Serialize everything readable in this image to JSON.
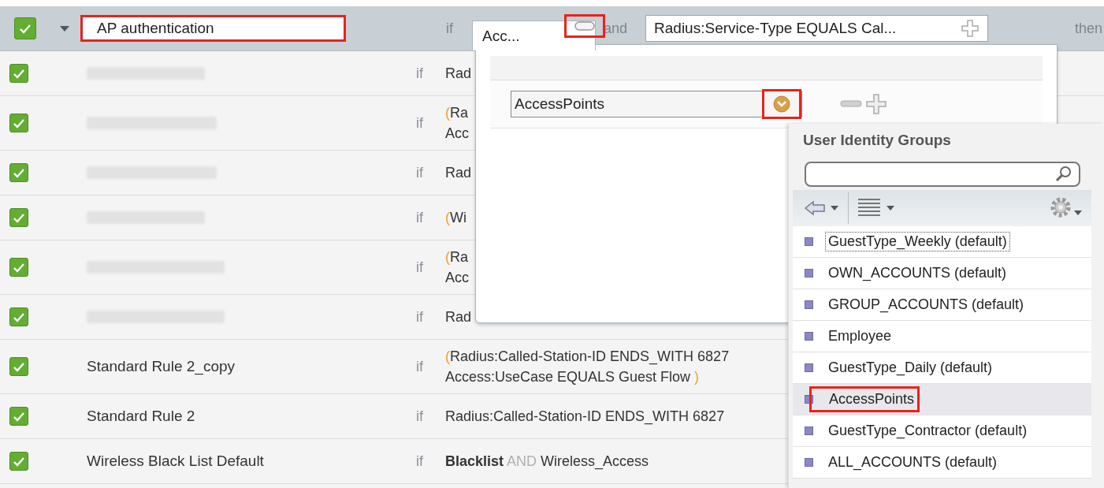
{
  "rule_editor": {
    "checked": true,
    "name_field": {
      "value": "AP authentication",
      "highlighted": true
    },
    "if_label": "if",
    "condition_tab": {
      "label": "Acc...",
      "selected": true
    },
    "remove_button": {
      "highlighted": true
    },
    "operator": "and",
    "second_condition": "Radius:Service-Type EQUALS Cal...",
    "then_label": "then"
  },
  "rules": [
    {
      "checked": true,
      "kind": "redacted",
      "if_label": "if",
      "condition": [
        [
          {
            "kind": "text",
            "text": "Rad"
          }
        ]
      ]
    },
    {
      "checked": true,
      "kind": "redacted",
      "if_label": "if",
      "condition": [
        [
          {
            "kind": "paren",
            "text": "("
          },
          {
            "kind": "text",
            "text": "Ra"
          }
        ],
        [
          {
            "kind": "text",
            "text": "Acc"
          }
        ]
      ]
    },
    {
      "checked": true,
      "kind": "redacted",
      "if_label": "if",
      "condition": [
        [
          {
            "kind": "text",
            "text": "Rad"
          }
        ]
      ]
    },
    {
      "checked": true,
      "kind": "redacted",
      "if_label": "if",
      "condition": [
        [
          {
            "kind": "paren",
            "text": "("
          },
          {
            "kind": "text",
            "text": "Wi"
          }
        ]
      ]
    },
    {
      "checked": true,
      "kind": "redacted",
      "if_label": "if",
      "condition": [
        [
          {
            "kind": "paren",
            "text": "("
          },
          {
            "kind": "text",
            "text": "Ra"
          }
        ],
        [
          {
            "kind": "text",
            "text": "Acc"
          }
        ]
      ]
    },
    {
      "checked": true,
      "kind": "redacted",
      "if_label": "if",
      "condition": [
        [
          {
            "kind": "text",
            "text": "Rad"
          }
        ]
      ]
    },
    {
      "checked": true,
      "kind": "named",
      "name": "Standard Rule 2_copy",
      "if_label": "if",
      "condition": [
        [
          {
            "kind": "paren",
            "text": "("
          },
          {
            "kind": "text",
            "text": "Radius:Called-Station-ID ENDS_WITH 6827"
          }
        ],
        [
          {
            "kind": "text",
            "text": "Access:UseCase EQUALS Guest Flow "
          },
          {
            "kind": "paren",
            "text": ")"
          }
        ]
      ]
    },
    {
      "checked": true,
      "kind": "named",
      "name": "Standard Rule 2",
      "if_label": "if",
      "condition": [
        [
          {
            "kind": "text",
            "text": "Radius:Called-Station-ID ENDS_WITH 6827"
          }
        ]
      ]
    },
    {
      "checked": true,
      "kind": "named",
      "name": "Wireless Black List Default",
      "if_label": "if",
      "condition": [
        [
          {
            "kind": "bold",
            "text": "Blacklist"
          },
          {
            "kind": "op",
            "text": " AND "
          },
          {
            "kind": "text",
            "text": "Wireless_Access"
          }
        ]
      ]
    }
  ],
  "condition_popup": {
    "attribute_field": {
      "value": "AccessPoints"
    },
    "dropdown_button": {
      "highlighted": true
    }
  },
  "identity_groups": {
    "title": "User Identity Groups",
    "items": [
      {
        "label": "GuestType_Weekly (default)",
        "selected": false,
        "focused": true,
        "highlighted": false
      },
      {
        "label": "OWN_ACCOUNTS (default)",
        "selected": false,
        "focused": false,
        "highlighted": false
      },
      {
        "label": "GROUP_ACCOUNTS (default)",
        "selected": false,
        "focused": false,
        "highlighted": false
      },
      {
        "label": "Employee",
        "selected": false,
        "focused": false,
        "highlighted": false
      },
      {
        "label": "GuestType_Daily (default)",
        "selected": false,
        "focused": false,
        "highlighted": false
      },
      {
        "label": "AccessPoints",
        "selected": true,
        "focused": false,
        "highlighted": true
      },
      {
        "label": "GuestType_Contractor (default)",
        "selected": false,
        "focused": false,
        "highlighted": false
      },
      {
        "label": "ALL_ACCOUNTS (default)",
        "selected": false,
        "focused": false,
        "highlighted": false
      }
    ]
  }
}
